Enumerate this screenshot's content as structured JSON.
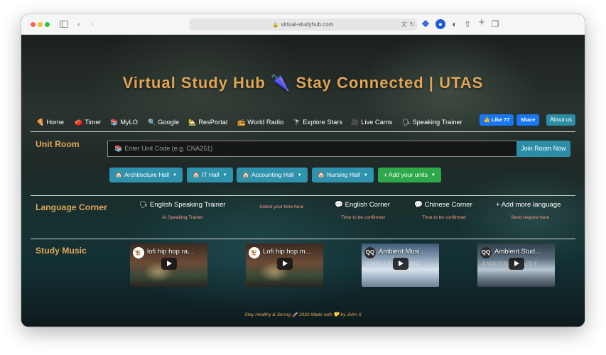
{
  "browser": {
    "url": "virtual-studyhub.com"
  },
  "page": {
    "title": "Virtual Study Hub 🌂 Stay Connected | UTAS"
  },
  "nav": [
    {
      "icon": "🍕",
      "label": "Home"
    },
    {
      "icon": "🍅",
      "label": "Timer"
    },
    {
      "icon": "📚",
      "label": "MyLO"
    },
    {
      "icon": "🔍",
      "label": "Google"
    },
    {
      "icon": "🏡",
      "label": "ResPortal"
    },
    {
      "icon": "📻",
      "label": "World Radio"
    },
    {
      "icon": "🔭",
      "label": "Explore Stars"
    },
    {
      "icon": "🎥",
      "label": "Live Cams"
    },
    {
      "icon": "🗣",
      "label": "Speaking Trainer"
    }
  ],
  "social": {
    "like_label": "👍 Like 77",
    "share_label": "Share",
    "about_label": "About us"
  },
  "unit_room": {
    "label": "Unit Room",
    "placeholder_icon": "📚",
    "placeholder": "Enter Unit Code (e.g. CNA251)",
    "join_label": "Join Room Now",
    "halls": [
      {
        "icon": "🏠",
        "label": "Architecture Hall"
      },
      {
        "icon": "🏠",
        "label": "IT Hall"
      },
      {
        "icon": "🏠",
        "label": "Accounting Hall"
      },
      {
        "icon": "🏠",
        "label": "Nursing Hall"
      }
    ],
    "add_units_label": "+ Add your units"
  },
  "language_corner": {
    "label": "Language Corner",
    "items": [
      {
        "title": "🗣 English Speaking Trainer",
        "sub": "AI Speaking Trainer"
      },
      {
        "title": "💬 English Corner",
        "sub": "Time to be confirmed"
      },
      {
        "title": "💬 Chinese Corner",
        "sub": "Time to be confirmed"
      },
      {
        "title": "+ Add more language",
        "sub": "Send request here"
      }
    ],
    "select_time": "Select your time here"
  },
  "study_music": {
    "label": "Study Music",
    "videos": [
      {
        "title": "lofi hip hop ra...",
        "avatar": "🐮",
        "watermark": ""
      },
      {
        "title": "Lofi hip hop m...",
        "avatar": "🐮",
        "watermark": ""
      },
      {
        "title": "Ambient Musi...",
        "avatar": "QQ",
        "watermark": "AMBIENT MUSIC"
      },
      {
        "title": "Ambient Stud...",
        "avatar": "QQ",
        "watermark": "AMBIENT STUDY"
      }
    ]
  },
  "footer": {
    "text": "Stay Healthy & Strong 🚀 2020 Made with 💛 by John X"
  }
}
